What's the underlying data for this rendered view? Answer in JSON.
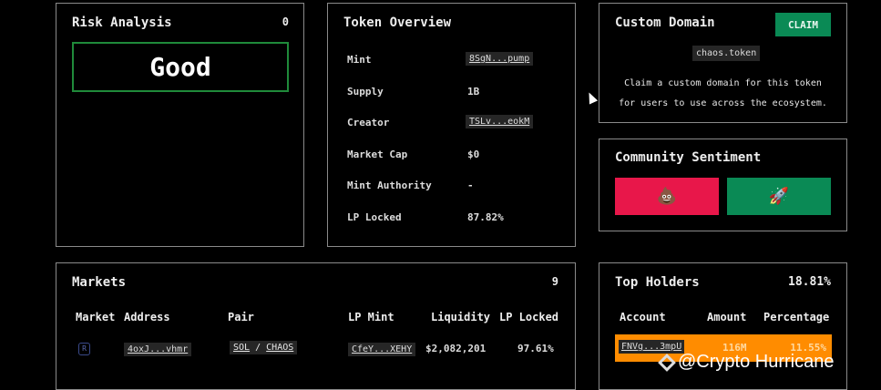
{
  "risk": {
    "title": "Risk Analysis",
    "count": "0",
    "rating": "Good"
  },
  "token": {
    "title": "Token Overview",
    "rows": [
      {
        "label": "Mint",
        "value": "8SgN...pump",
        "link": true
      },
      {
        "label": "Supply",
        "value": "1B",
        "link": false
      },
      {
        "label": "Creator",
        "value": "TSLv...eokM",
        "link": true
      },
      {
        "label": "Market Cap",
        "value": "$0",
        "link": false
      },
      {
        "label": "Mint Authority",
        "value": "-",
        "link": false
      },
      {
        "label": "LP Locked",
        "value": "87.82%",
        "link": false
      }
    ]
  },
  "domain": {
    "title": "Custom Domain",
    "claim": "CLAIM",
    "name": "chaos.token",
    "desc1": "Claim a custom domain for this token",
    "desc2": "for users to use across the ecosystem."
  },
  "sentiment": {
    "title": "Community Sentiment",
    "bad": "💩",
    "good": "🚀"
  },
  "markets": {
    "title": "Markets",
    "count": "9",
    "headers": [
      "Market",
      "Address",
      "Pair",
      "LP Mint",
      "Liquidity",
      "LP Locked"
    ],
    "rows": [
      {
        "address": "4oxJ...vhmr",
        "base": "SOL",
        "sep": "/",
        "quote": "CHAOS",
        "lp_mint": "CfeY...XEHY",
        "liquidity": "$2,082,201",
        "lp_locked": "97.61%"
      }
    ]
  },
  "holders": {
    "title": "Top Holders",
    "total": "18.81%",
    "headers": [
      "Account",
      "Amount",
      "Percentage"
    ],
    "rows": [
      {
        "account": "FNVg...3mpU",
        "amount": "116M",
        "percentage": "11.55%"
      }
    ]
  },
  "watermark": "@Crypto Hurricane",
  "colors": {
    "green": "#0a8a55",
    "red": "#e8174a",
    "orange": "#ff8c00"
  }
}
